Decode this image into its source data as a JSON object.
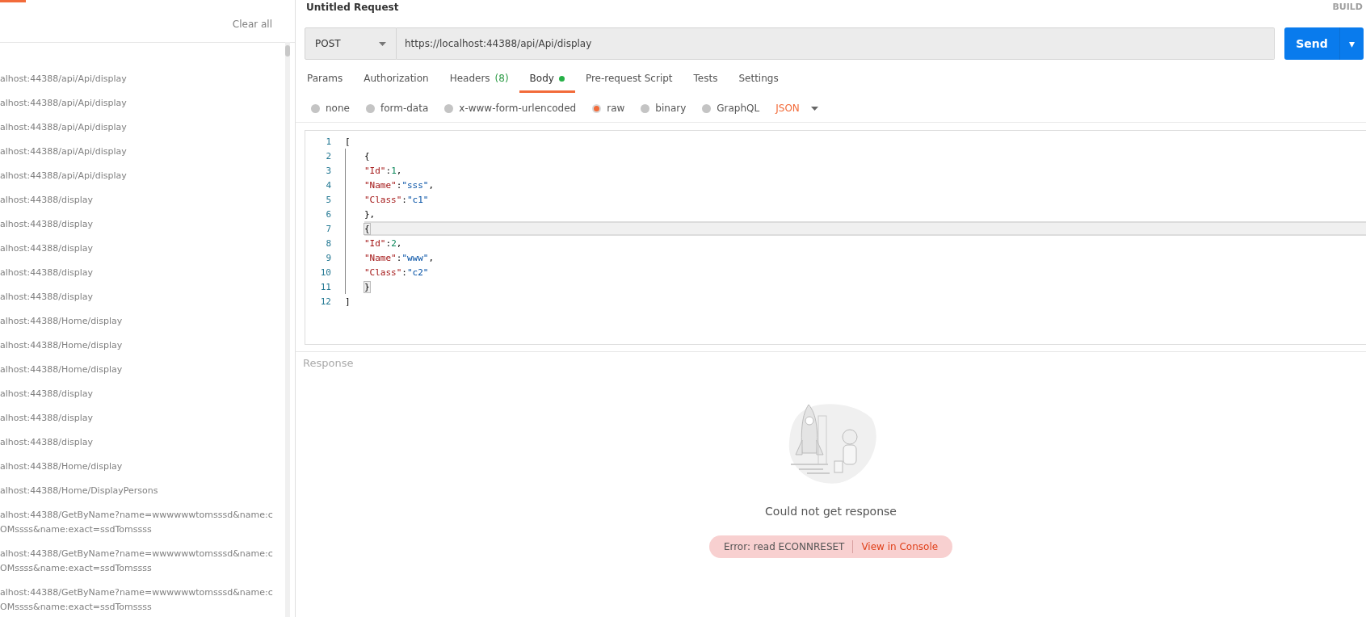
{
  "sidebar": {
    "clear_all": "Clear all",
    "history": [
      {
        "lines": [
          "alhost:44388/api/Api/display"
        ]
      },
      {
        "lines": [
          "alhost:44388/api/Api/display"
        ]
      },
      {
        "lines": [
          "alhost:44388/api/Api/display"
        ]
      },
      {
        "lines": [
          "alhost:44388/api/Api/display"
        ]
      },
      {
        "lines": [
          "alhost:44388/api/Api/display"
        ]
      },
      {
        "lines": [
          "alhost:44388/display"
        ]
      },
      {
        "lines": [
          "alhost:44388/display"
        ]
      },
      {
        "lines": [
          "alhost:44388/display"
        ]
      },
      {
        "lines": [
          "alhost:44388/display"
        ]
      },
      {
        "lines": [
          "alhost:44388/display"
        ]
      },
      {
        "lines": [
          "alhost:44388/Home/display"
        ]
      },
      {
        "lines": [
          "alhost:44388/Home/display"
        ]
      },
      {
        "lines": [
          "alhost:44388/Home/display"
        ]
      },
      {
        "lines": [
          "alhost:44388/display"
        ]
      },
      {
        "lines": [
          "alhost:44388/display"
        ]
      },
      {
        "lines": [
          "alhost:44388/display"
        ]
      },
      {
        "lines": [
          "alhost:44388/Home/display"
        ]
      },
      {
        "lines": [
          "alhost:44388/Home/DisplayPersons"
        ]
      },
      {
        "lines": [
          "alhost:44388/GetByName?name=wwwwwwtomsssd&name:c",
          "OMssss&name:exact=ssdTomssss"
        ]
      },
      {
        "lines": [
          "alhost:44388/GetByName?name=wwwwwwtomsssd&name:c",
          "OMssss&name:exact=ssdTomssss"
        ]
      },
      {
        "lines": [
          "alhost:44388/GetByName?name=wwwwwwtomsssd&name:c",
          "OMssss&name:exact=ssdTomssss"
        ]
      }
    ]
  },
  "request": {
    "title": "Untitled Request",
    "build": "BUILD",
    "method": "POST",
    "url": "https://localhost:44388/api/Api/display",
    "send": "Send",
    "caret": "▾",
    "tabs": [
      {
        "label": "Params",
        "selected": false,
        "dot": false
      },
      {
        "label": "Authorization",
        "selected": false,
        "dot": false
      },
      {
        "label": "Headers",
        "count": "(8)",
        "selected": false,
        "dot": false
      },
      {
        "label": "Body",
        "selected": true,
        "dot": true
      },
      {
        "label": "Pre-request Script",
        "selected": false,
        "dot": false
      },
      {
        "label": "Tests",
        "selected": false,
        "dot": false
      },
      {
        "label": "Settings",
        "selected": false,
        "dot": false
      }
    ],
    "body_types": [
      {
        "label": "none",
        "selected": false
      },
      {
        "label": "form-data",
        "selected": false
      },
      {
        "label": "x-www-form-urlencoded",
        "selected": false
      },
      {
        "label": "raw",
        "selected": true
      },
      {
        "label": "binary",
        "selected": false
      },
      {
        "label": "GraphQL",
        "selected": false
      }
    ],
    "format": "JSON",
    "editor": [
      {
        "number": "1",
        "indented": false,
        "active": false,
        "tokens": [
          {
            "kind": "punct",
            "text": "["
          }
        ]
      },
      {
        "number": "2",
        "indented": true,
        "active": false,
        "tokens": [
          {
            "kind": "punct",
            "text": "{"
          }
        ]
      },
      {
        "number": "3",
        "indented": true,
        "active": false,
        "tokens": [
          {
            "kind": "key",
            "text": "\"Id\""
          },
          {
            "kind": "punct",
            "text": ":"
          },
          {
            "kind": "number",
            "text": "1"
          },
          {
            "kind": "punct",
            "text": ","
          }
        ]
      },
      {
        "number": "4",
        "indented": true,
        "active": false,
        "tokens": [
          {
            "kind": "key",
            "text": "\"Name\""
          },
          {
            "kind": "punct",
            "text": ":"
          },
          {
            "kind": "string",
            "text": "\"sss\""
          },
          {
            "kind": "punct",
            "text": ","
          }
        ]
      },
      {
        "number": "5",
        "indented": true,
        "active": false,
        "tokens": [
          {
            "kind": "key",
            "text": "\"Class\""
          },
          {
            "kind": "punct",
            "text": ":"
          },
          {
            "kind": "string",
            "text": "\"c1\""
          }
        ]
      },
      {
        "number": "6",
        "indented": true,
        "active": false,
        "tokens": [
          {
            "kind": "punct",
            "text": "},"
          }
        ]
      },
      {
        "number": "7",
        "indented": true,
        "active": true,
        "tokens": [
          {
            "kind": "match",
            "text": "{"
          }
        ]
      },
      {
        "number": "8",
        "indented": true,
        "active": false,
        "tokens": [
          {
            "kind": "key",
            "text": "\"Id\""
          },
          {
            "kind": "punct",
            "text": ":"
          },
          {
            "kind": "number",
            "text": "2"
          },
          {
            "kind": "punct",
            "text": ","
          }
        ]
      },
      {
        "number": "9",
        "indented": true,
        "active": false,
        "tokens": [
          {
            "kind": "key",
            "text": "\"Name\""
          },
          {
            "kind": "punct",
            "text": ":"
          },
          {
            "kind": "string",
            "text": "\"www\""
          },
          {
            "kind": "punct",
            "text": ","
          }
        ]
      },
      {
        "number": "10",
        "indented": true,
        "active": false,
        "tokens": [
          {
            "kind": "key",
            "text": "\"Class\""
          },
          {
            "kind": "punct",
            "text": ":"
          },
          {
            "kind": "string",
            "text": "\"c2\""
          }
        ]
      },
      {
        "number": "11",
        "indented": true,
        "active": false,
        "tokens": [
          {
            "kind": "match",
            "text": "}"
          }
        ]
      },
      {
        "number": "12",
        "indented": false,
        "active": false,
        "tokens": [
          {
            "kind": "punct",
            "text": "]"
          }
        ]
      }
    ]
  },
  "response": {
    "label": "Response",
    "message": "Could not get response",
    "error": "Error: read ECONNRESET",
    "console_link": "View in Console"
  }
}
